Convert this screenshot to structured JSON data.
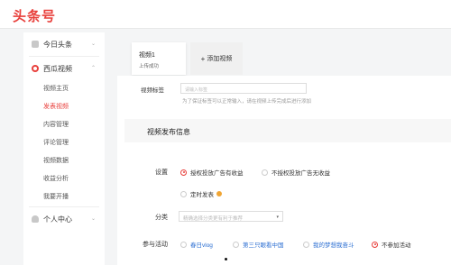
{
  "app": {
    "logo": "头条号"
  },
  "sidebar": {
    "groups": [
      {
        "label": "今日头条",
        "chev": "⌄"
      },
      {
        "label": "西瓜视频",
        "chev": "⌃",
        "items": [
          {
            "label": "视频主页"
          },
          {
            "label": "发表视频"
          },
          {
            "label": "内容管理"
          },
          {
            "label": "评论管理"
          },
          {
            "label": "视频数据"
          },
          {
            "label": "收益分析"
          },
          {
            "label": "我要开播"
          }
        ]
      },
      {
        "label": "个人中心",
        "chev": "⌄"
      }
    ]
  },
  "tabs": {
    "video_title": "视频1",
    "video_status": "上传成功",
    "add_label": "添加视频",
    "add_icon": "+"
  },
  "form": {
    "tag_label": "视频标签",
    "tag_placeholder": "请输入标签",
    "tag_hint": "为了保证标签可以正常输入，请在视频上传完成后进行添加",
    "section_title": "视频发布信息",
    "settings_label": "设置",
    "ad_on": "授权投放广告有收益",
    "ad_off": "不授权投放广告无收益",
    "schedule": "定时发表",
    "category_label": "分类",
    "category_placeholder": "精确选择分类更有利于推荐",
    "category_arrow": "▾",
    "activity_label": "参与活动",
    "activities": [
      "春日vlog",
      "第三只眼看中国",
      "我的梦想我奋斗",
      "不参加活动"
    ]
  },
  "colors": {
    "brand": "#e8403c",
    "link": "#2b6ed2"
  }
}
